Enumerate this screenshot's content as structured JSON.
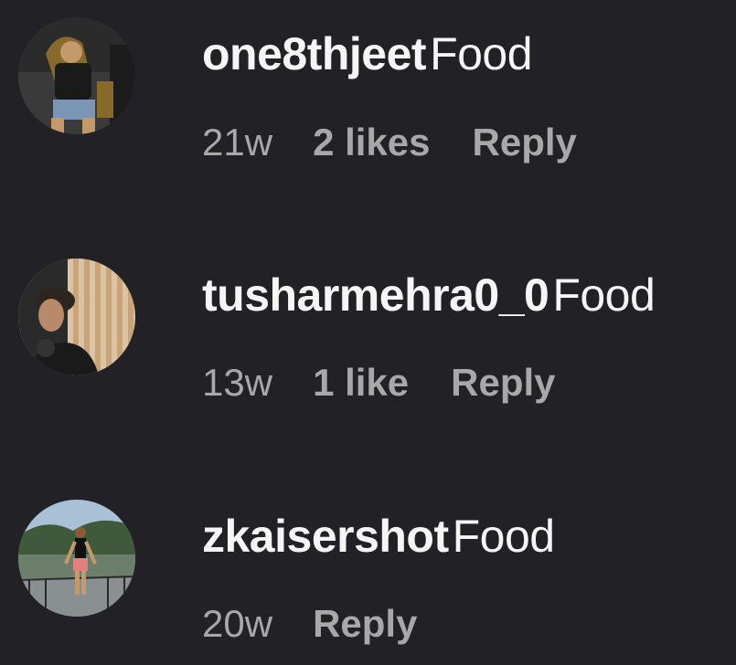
{
  "colors": {
    "background": "#212126",
    "primary_text": "#f5f5f5",
    "secondary_text": "#a8a8a8"
  },
  "comments": [
    {
      "username": "one8thjeet",
      "text": "Food",
      "time": "21w",
      "likes": "2 likes",
      "reply_label": "Reply",
      "avatar_icon": "user-avatar-throne-photo"
    },
    {
      "username": "tusharmehra0_0",
      "text": "Food",
      "time": "13w",
      "likes": "1 like",
      "reply_label": "Reply",
      "avatar_icon": "user-avatar-portrait-photo"
    },
    {
      "username": "zkaisershot",
      "text": "Food",
      "time": "20w",
      "reply_label": "Reply",
      "avatar_icon": "user-avatar-lake-photo"
    }
  ]
}
